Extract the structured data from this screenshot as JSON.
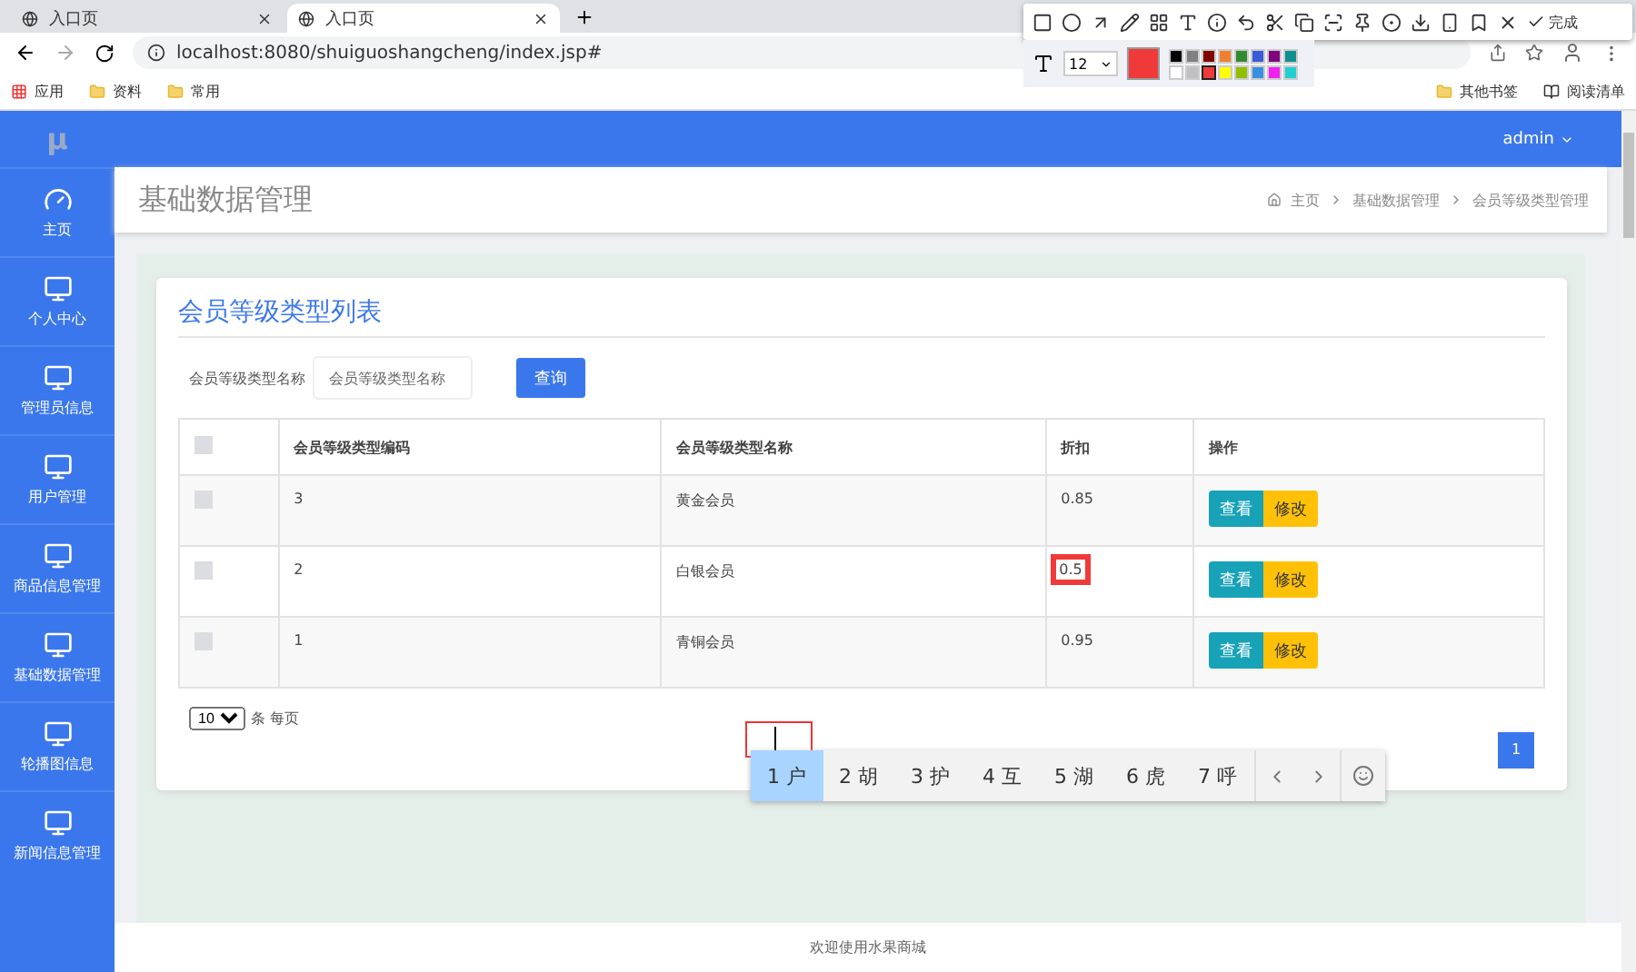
{
  "browser": {
    "tabs": [
      {
        "title": "入口页",
        "selected": false
      },
      {
        "title": "入口页",
        "selected": true
      }
    ],
    "url": "localhost:8080/shuiguoshangcheng/index.jsp#",
    "bookmarks": [
      "应用",
      "资料",
      "常用"
    ],
    "bookmarks_right": [
      "其他书签",
      "阅读清单"
    ]
  },
  "capture_toolbar": {
    "done": "完成",
    "font_size": "12",
    "palette": [
      {
        "color": "#000000",
        "selected": false
      },
      {
        "color": "#808080",
        "selected": false
      },
      {
        "color": "#800000",
        "selected": false
      },
      {
        "color": "#f08030",
        "selected": false
      },
      {
        "color": "#2e8b2e",
        "selected": false
      },
      {
        "color": "#3a5ad8",
        "selected": false
      },
      {
        "color": "#800080",
        "selected": false
      },
      {
        "color": "#109090",
        "selected": false
      },
      {
        "color": "#ffffff",
        "selected": false
      },
      {
        "color": "#c0c0c0",
        "selected": false
      },
      {
        "color": "#f03a3a",
        "selected": true
      },
      {
        "color": "#ffff00",
        "selected": false
      },
      {
        "color": "#90c000",
        "selected": false
      },
      {
        "color": "#3a90e0",
        "selected": false
      },
      {
        "color": "#f020f0",
        "selected": false
      },
      {
        "color": "#20d0d0",
        "selected": false
      }
    ]
  },
  "app": {
    "logo": "μ",
    "user": "admin",
    "sidebar": [
      {
        "label": "主页",
        "kind": "home",
        "selected": false
      },
      {
        "label": "个人中心",
        "kind": "section",
        "selected": false
      },
      {
        "label": "管理员信息",
        "kind": "section",
        "selected": false
      },
      {
        "label": "用户管理",
        "kind": "section",
        "selected": false
      },
      {
        "label": "商品信息管理",
        "kind": "section",
        "selected": false
      },
      {
        "label": "基础数据管理",
        "kind": "section",
        "selected": false
      },
      {
        "label": "轮播图信息",
        "kind": "section",
        "selected": false
      },
      {
        "label": "新闻信息管理",
        "kind": "section",
        "selected": false
      }
    ],
    "page_title": "基础数据管理",
    "breadcrumb": [
      "主页",
      "基础数据管理",
      "会员等级类型管理"
    ],
    "card_title": "会员等级类型列表",
    "search": {
      "label": "会员等级类型名称",
      "placeholder": "会员等级类型名称",
      "button": "查询"
    },
    "table": {
      "select_all_checked": false,
      "columns": [
        "会员等级类型编码",
        "会员等级类型名称",
        "折扣",
        "操作"
      ],
      "rows": [
        {
          "code": "3",
          "name": "黄金会员",
          "discount": "0.85",
          "checked": false,
          "highlighted": false,
          "actions": [
            "查看",
            "修改"
          ]
        },
        {
          "code": "2",
          "name": "白银会员",
          "discount": "0.5",
          "checked": false,
          "highlighted": true,
          "actions": [
            "查看",
            "修改"
          ]
        },
        {
          "code": "1",
          "name": "青铜会员",
          "discount": "0.95",
          "checked": false,
          "highlighted": false,
          "actions": [
            "查看",
            "修改"
          ]
        }
      ]
    },
    "page_size": "10",
    "page_size_label": "条 每页",
    "pages": [
      {
        "label": "1",
        "selected": true
      }
    ],
    "footer": "欢迎使用水果商城"
  },
  "ime": {
    "candidates": [
      {
        "label": "1 户",
        "selected": true
      },
      {
        "label": "2 胡",
        "selected": false
      },
      {
        "label": "3 护",
        "selected": false
      },
      {
        "label": "4 互",
        "selected": false
      },
      {
        "label": "5 湖",
        "selected": false
      },
      {
        "label": "6 虎",
        "selected": false
      },
      {
        "label": "7 呼",
        "selected": false
      }
    ]
  }
}
